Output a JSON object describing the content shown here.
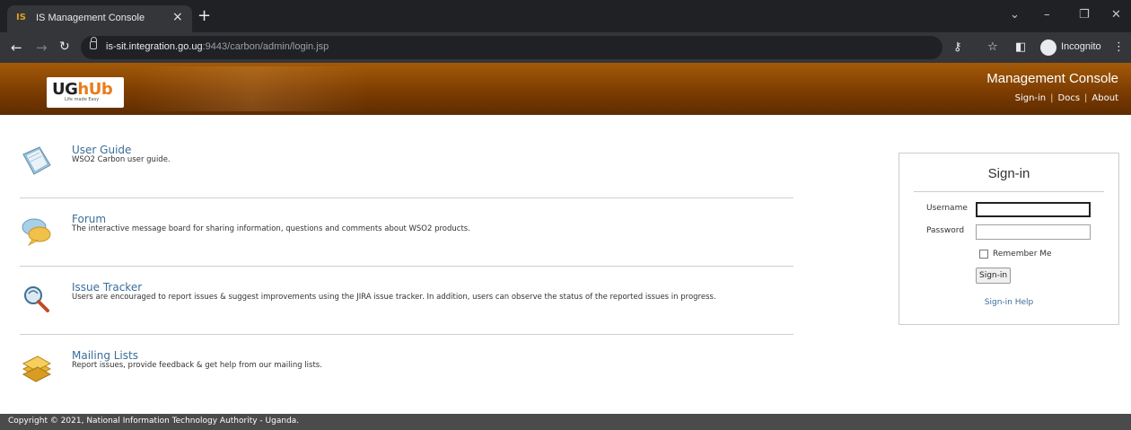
{
  "browser": {
    "tab_title": "IS Management Console",
    "tab_favicon": "IS",
    "url_host": "is-sit.integration.go.ug",
    "url_path": ":9443/carbon/admin/login.jsp",
    "incognito_label": "Incognito"
  },
  "header": {
    "logo_main": "UG",
    "logo_accent": "hUb",
    "logo_tagline": "Life made Easy",
    "title": "Management Console",
    "links": {
      "signin": "Sign-in",
      "docs": "Docs",
      "about": "About"
    }
  },
  "resources": [
    {
      "title": "User Guide",
      "description": "WSO2 Carbon user guide.",
      "icon": "user-guide-book-icon"
    },
    {
      "title": "Forum",
      "description": "The interactive message board for sharing information, questions and comments about WSO2 products.",
      "icon": "forum-chat-bubbles-icon"
    },
    {
      "title": "Issue Tracker",
      "description": "Users are encouraged to report issues & suggest improvements using the JIRA issue tracker. In addition, users can observe the status of the reported issues in progress.",
      "icon": "issue-tracker-magnifier-icon"
    },
    {
      "title": "Mailing Lists",
      "description": "Report issues, provide feedback & get help from our mailing lists.",
      "icon": "mailing-list-envelopes-icon"
    }
  ],
  "login": {
    "title": "Sign-in",
    "username_label": "Username",
    "username_value": "",
    "password_label": "Password",
    "password_value": "",
    "remember_label": "Remember Me",
    "button_label": "Sign-in",
    "help_link": "Sign-in Help"
  },
  "footer": {
    "text": "Copyright © 2021, National Information Technology Authority - Uganda."
  },
  "colors": {
    "header_brown": "#7d3d02",
    "link_blue": "#3a6d9a",
    "footer_gray": "#4b4b4b"
  }
}
